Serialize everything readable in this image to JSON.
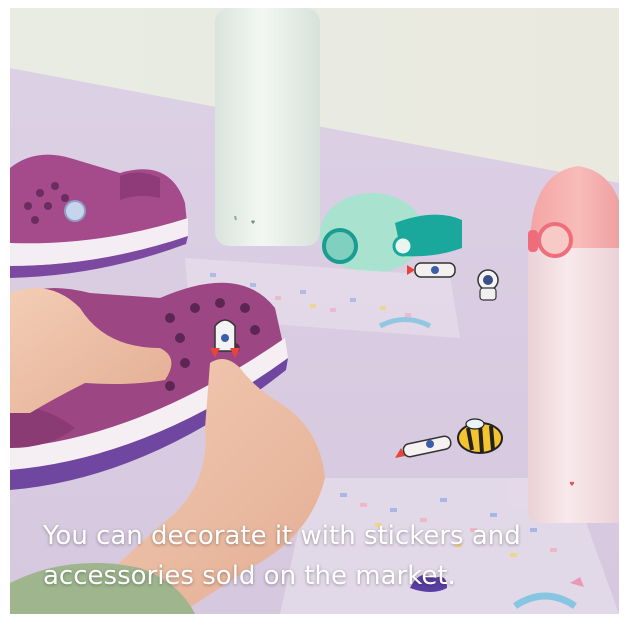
{
  "caption": {
    "line1": "You can decorate it with stickers and",
    "line2": "accessories sold on the market."
  },
  "colors": {
    "background": "#e4d9ea",
    "table": "#d9cde3",
    "wall": "#e9ebe4",
    "clog": "#a54a8b",
    "pink_bottle": "#f6dfe2",
    "white_bottle": "#e9f0ea",
    "mint_cap": "#a8e3cf",
    "teal_strap": "#19a59a"
  },
  "icons": [
    "rocket-charm",
    "bee-charm",
    "astronaut-charm",
    "heart-logo"
  ]
}
